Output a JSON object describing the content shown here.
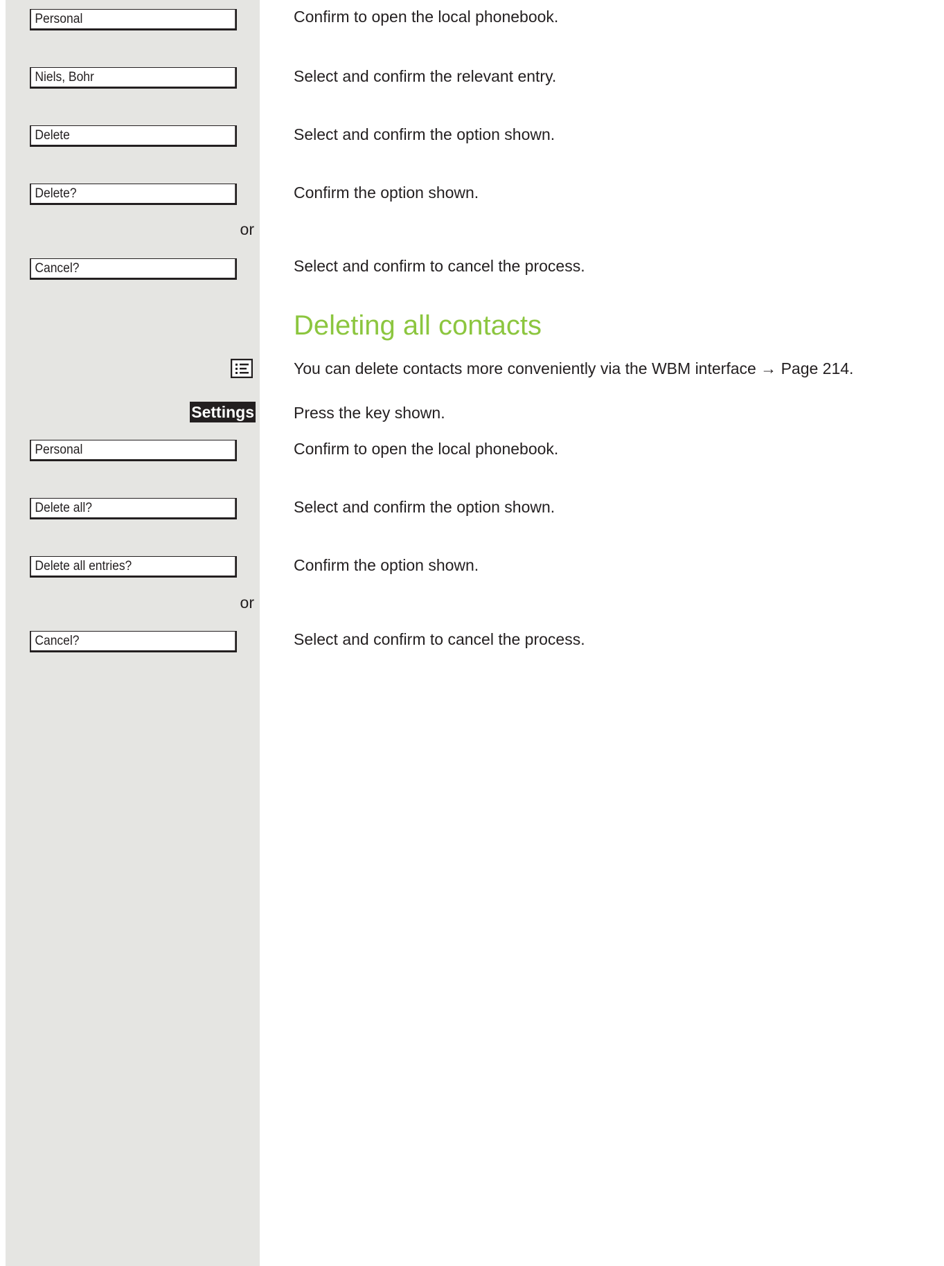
{
  "colors": {
    "sidebar": "#e5e5e2",
    "heading": "#8cc63f",
    "text": "#231f20"
  },
  "section1": {
    "steps": [
      {
        "display": "Personal",
        "text": "Confirm to open the local phonebook."
      },
      {
        "display": "Niels, Bohr",
        "text": "Select and confirm the relevant entry."
      },
      {
        "display": "Delete",
        "text": "Select and confirm the option shown."
      },
      {
        "display": "Delete?",
        "text": "Confirm the option shown."
      },
      {
        "display": "Cancel?",
        "text": "Select and confirm to cancel the process."
      }
    ],
    "or": "or"
  },
  "section2": {
    "heading": "Deleting all contacts",
    "note_icon": "list-icon",
    "note": "You can delete contacts more conveniently via the WBM interface → Page 214.",
    "key_label": "Settings",
    "key_text": "Press the key shown.",
    "steps": [
      {
        "display": "Personal",
        "text": "Confirm to open the local phonebook."
      },
      {
        "display": "Delete all?",
        "text": "Select and confirm the option shown."
      },
      {
        "display": "Delete all entries?",
        "text": "Confirm the option shown."
      },
      {
        "display": "Cancel?",
        "text": "Select and confirm to cancel the process."
      }
    ],
    "or": "or"
  }
}
